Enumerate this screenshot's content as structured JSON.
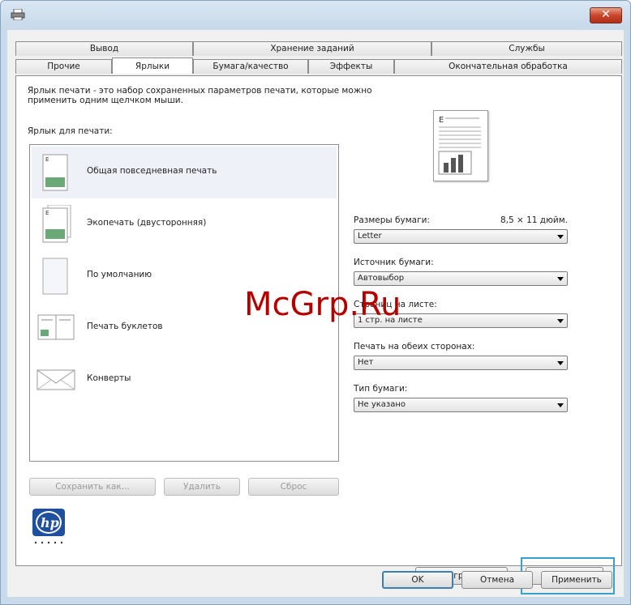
{
  "window": {
    "close_label": "✕"
  },
  "tabs_row1": [
    "Вывод",
    "Хранение заданий",
    "Службы"
  ],
  "tabs_row2": [
    "Прочие",
    "Ярлыки",
    "Бумага/качество",
    "Эффекты",
    "Окончательная обработка"
  ],
  "active_tab": "Ярлыки",
  "panel": {
    "description": "Ярлык печати - это набор сохраненных параметров печати, которые можно применить одним щелчком мыши.",
    "list_label": "Ярлык для печати:",
    "shortcuts": [
      {
        "label": "Общая повседневная печать",
        "selected": true
      },
      {
        "label": "Экопечать (двусторонняя)",
        "selected": false
      },
      {
        "label": "По умолчанию",
        "selected": false
      },
      {
        "label": "Печать буклетов",
        "selected": false
      },
      {
        "label": "Конверты",
        "selected": false
      }
    ],
    "fields": [
      {
        "label": "Размеры бумаги:",
        "extra": "8,5 × 11 дюйм.",
        "value": "Letter"
      },
      {
        "label": "Источник бумаги:",
        "extra": "",
        "value": "Автовыбор"
      },
      {
        "label": "Страниц на листе:",
        "extra": "",
        "value": "1 стр. на листе"
      },
      {
        "label": "Печать на обеих сторонах:",
        "extra": "",
        "value": "Нет"
      },
      {
        "label": "Тип бумаги:",
        "extra": "",
        "value": "Не указано"
      }
    ],
    "buttons": {
      "save_as": "Сохранить как...",
      "delete": "Удалить",
      "reset": "Сброс"
    },
    "about": "О программе...",
    "help": "Справка"
  },
  "dialog_buttons": {
    "ok": "OK",
    "cancel": "Отмена",
    "apply": "Применить"
  },
  "logo_text": "hp",
  "watermark": "McGrp.Ru",
  "colors": {
    "highlight": "#3aa0d0",
    "close": "#c9452a",
    "watermark": "#b50000"
  }
}
